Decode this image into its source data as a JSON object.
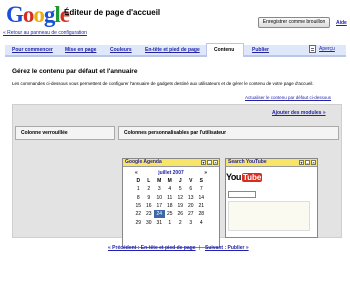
{
  "header": {
    "logo": [
      "G",
      "o",
      "o",
      "g",
      "l",
      "e"
    ],
    "app_title": "Éditeur de page d'accueil",
    "back_link": "« Retour au panneau de configuration",
    "save_button": "Enregistrer comme brouillon",
    "help_link": "Aide"
  },
  "tabs": [
    {
      "label": "Pour commencer",
      "active": false
    },
    {
      "label": "Mise en page",
      "active": false
    },
    {
      "label": "Couleurs",
      "active": false
    },
    {
      "label": "En-tête et pied de page",
      "active": false
    },
    {
      "label": "Contenu",
      "active": true
    },
    {
      "label": "Publier",
      "active": false
    }
  ],
  "preview_link": "Aperçu",
  "content": {
    "title": "Gérez le contenu par défaut et l'annuaire",
    "description": "Les commandes ci-dessous vous permettent de configurer l'annuaire de gadgets destiné aux utilisateurs et de gérer le contenu de votre page d'accueil.",
    "update_link": "Actualiser le contenu par défaut ci-dessous",
    "add_modules_link": "Ajouter des modules »",
    "locked_column": "Colonne verrouillée",
    "custom_columns": "Colonnes personnalisables par l'utilisateur"
  },
  "gadgets": {
    "agenda": {
      "title": "Google Agenda",
      "prev": "«",
      "month": "juillet 2007",
      "next": "»",
      "weekdays": [
        "D",
        "L",
        "M",
        "M",
        "J",
        "V",
        "S"
      ],
      "weeks": [
        [
          "1",
          "2",
          "3",
          "4",
          "5",
          "6",
          "7"
        ],
        [
          "8",
          "9",
          "10",
          "11",
          "12",
          "13",
          "14"
        ],
        [
          "15",
          "16",
          "17",
          "18",
          "19",
          "20",
          "21"
        ],
        [
          "22",
          "23",
          "24",
          "25",
          "26",
          "27",
          "28"
        ],
        [
          "29",
          "30",
          "31",
          "1",
          "2",
          "3",
          "4"
        ]
      ],
      "selected": "24"
    },
    "youtube": {
      "title": "Search YouTube",
      "logo_you": "You",
      "logo_tube": "Tube"
    }
  },
  "footer": {
    "prev": "« Précédent : En-tête et pied de page",
    "next": "Suivant : Publier »"
  },
  "colors": {
    "tab_bar": "#dfe8fa",
    "gadget_header": "#f7e56a",
    "calendar_selected": "#3d68a8",
    "link": "#2222aa"
  }
}
